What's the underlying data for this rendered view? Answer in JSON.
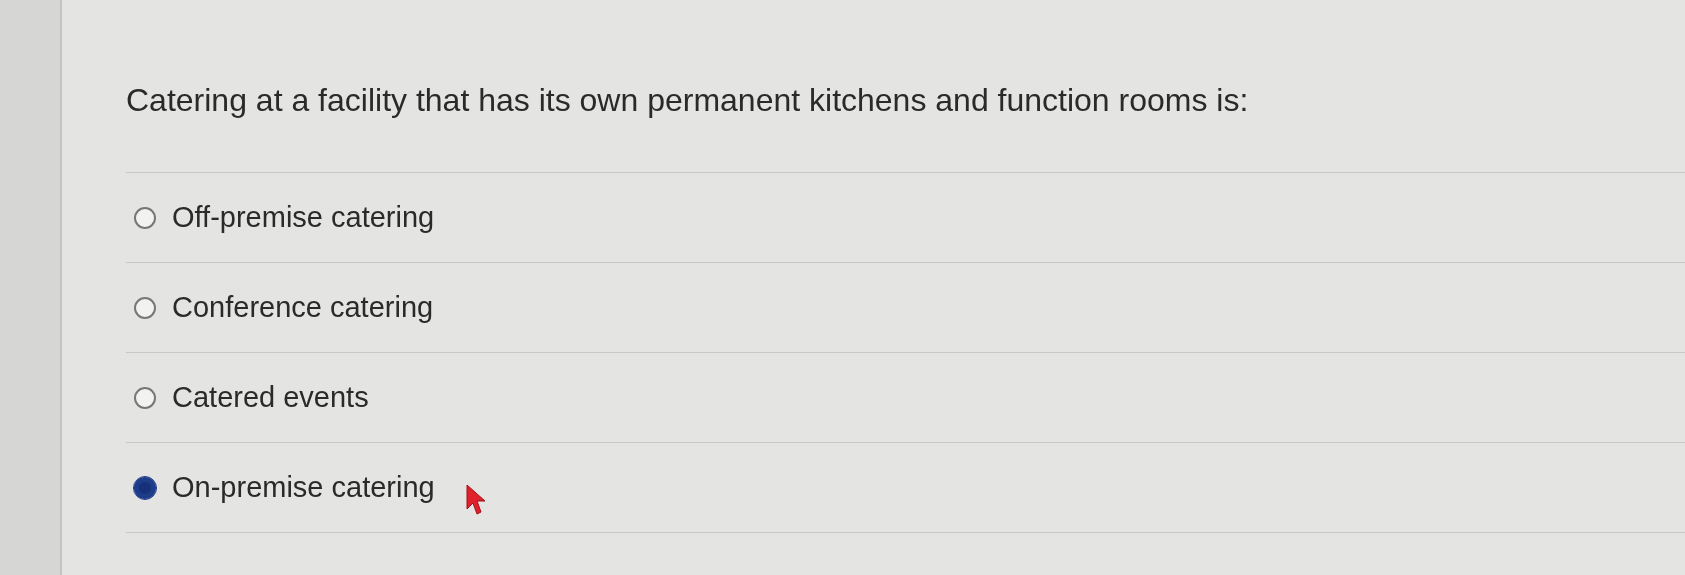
{
  "question": "Catering at a facility that has its own permanent kitchens and function rooms is:",
  "options": [
    {
      "label": "Off-premise catering",
      "selected": false
    },
    {
      "label": "Conference catering",
      "selected": false
    },
    {
      "label": "Catered events",
      "selected": false
    },
    {
      "label": "On-premise catering",
      "selected": true
    }
  ]
}
